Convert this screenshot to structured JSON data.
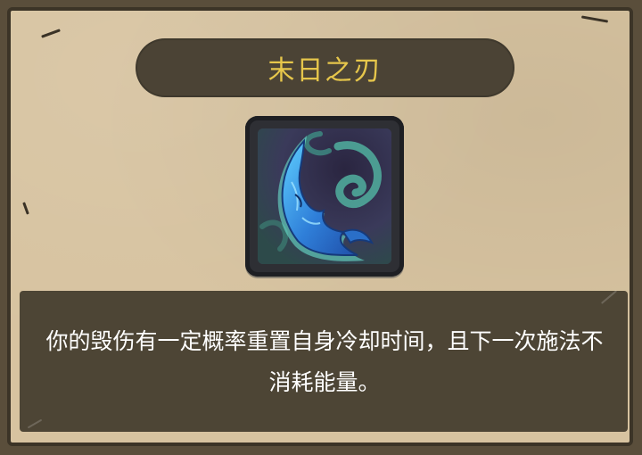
{
  "skill": {
    "title": "末日之刃",
    "icon": "scythe-blade-icon",
    "description": "你的毁伤有一定概率重置自身冷却时间，且下一次施法不消耗能量。"
  },
  "colors": {
    "panel_bg": "#d7c3a0",
    "title_bar_bg": "#4b4335",
    "title_text": "#e6c64b",
    "desc_bg": "#4d4535",
    "desc_text": "#ffffff"
  }
}
